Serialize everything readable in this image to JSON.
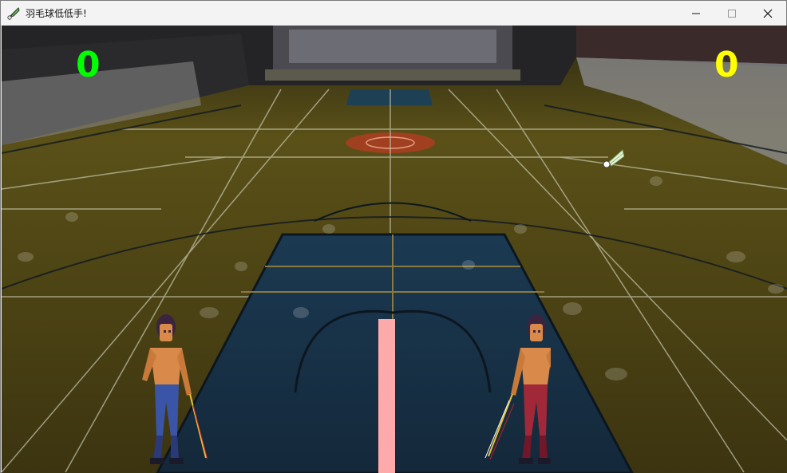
{
  "window": {
    "title": "羽毛球低低手!",
    "minimize_icon": "minimize-icon",
    "maximize_icon": "maximize-icon",
    "close_icon": "close-icon",
    "app_icon": "shuttlecock-icon"
  },
  "scoreboard": {
    "left_score": "0",
    "right_score": "0",
    "left_color": "#00ff00",
    "right_color": "#ffff00"
  },
  "colors": {
    "net": "#ffaaaa",
    "floor": "#5a4e18",
    "court": "#1d3a52",
    "left_player_pants": "#3a55a8",
    "right_player_pants": "#a02838"
  }
}
